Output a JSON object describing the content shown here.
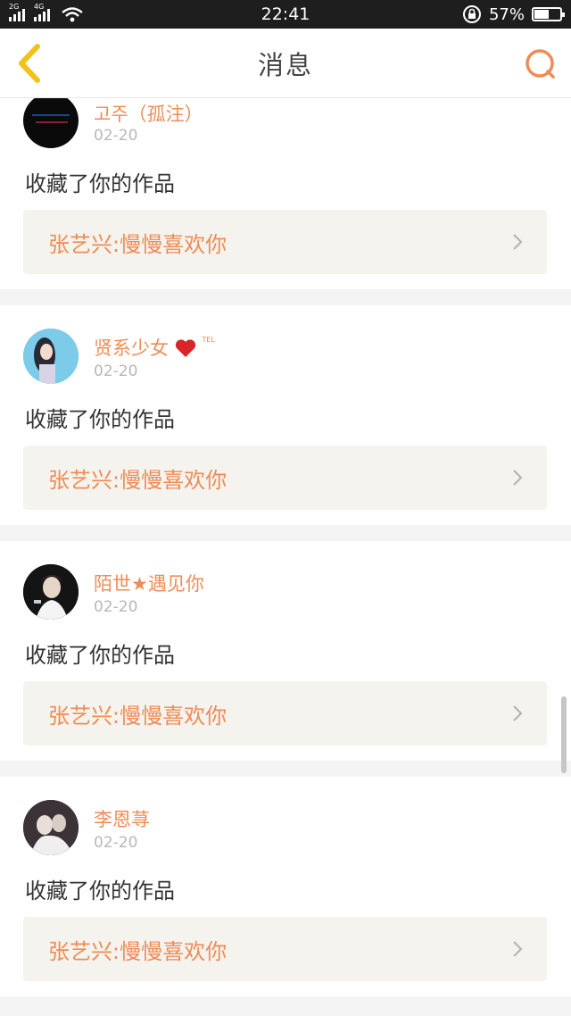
{
  "status_bar": {
    "network_1": "2G",
    "network_2": "4G",
    "time": "22:41",
    "battery_percent": "57%",
    "battery_level": 0.57
  },
  "header": {
    "title": "消息",
    "back_icon": "chevron-left-icon",
    "search_icon": "search-icon"
  },
  "messages": [
    {
      "username": "고주（孤注）",
      "date": "02-20",
      "action": "收藏了你的作品",
      "work_title": "张艺兴:慢慢喜欢你"
    },
    {
      "username": "贤系少女",
      "badge": "TEL",
      "date": "02-20",
      "action": "收藏了你的作品",
      "work_title": "张艺兴:慢慢喜欢你"
    },
    {
      "username": "陌世★遇见你",
      "date": "02-20",
      "action": "收藏了你的作品",
      "work_title": "张艺兴:慢慢喜欢你"
    },
    {
      "username": "李恩荨",
      "date": "02-20",
      "action": "收藏了你的作品",
      "work_title": "张艺兴:慢慢喜欢你"
    }
  ],
  "colors": {
    "accent": "#ee8c58",
    "back_icon": "#f2c21b",
    "link_bg": "#f5f3ee"
  }
}
